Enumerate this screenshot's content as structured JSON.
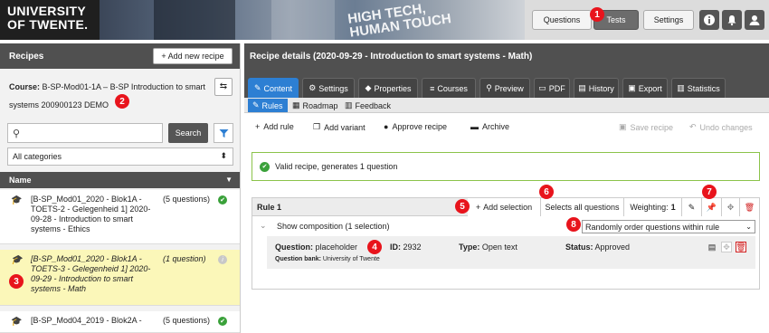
{
  "colors": {
    "accent": "#2d7fd3",
    "marker": "#e8141c",
    "success": "#3aa13a",
    "highlight": "#fbf7b9",
    "danger": "#d02020"
  },
  "header": {
    "logo_line1": "UNIVERSITY",
    "logo_line2": "OF TWENTE.",
    "banner_text_1": "HIGH TECH,",
    "banner_text_2": "HUMAN TOUCH",
    "nav": {
      "questions": "Questions",
      "tests": "Tests",
      "settings": "Settings"
    },
    "icons": [
      "info-icon",
      "bell-icon",
      "user-icon"
    ]
  },
  "markers": [
    "1",
    "2",
    "3",
    "4",
    "5",
    "6",
    "7",
    "8"
  ],
  "left": {
    "title": "Recipes",
    "add_button": "+ Add new recipe",
    "course_label": "Course:",
    "course_value": "B-SP-Mod01-1A – B-SP Introduction to smart systems 200900123 DEMO",
    "search_placeholder": "",
    "search_button": "Search",
    "category_select": "All categories",
    "list_header": "Name",
    "items": [
      {
        "text": "[B-SP_Mod01_2020 - Blok1A - TOETS-2 - Gelegenheid 1] 2020-09-28 - Introduction to smart systems - Ethics",
        "count": "(5 questions)",
        "status": "valid"
      },
      {
        "text": "[B-SP_Mod01_2020 - Blok1A - TOETS-3 - Gelegenheid 1] 2020-09-29 - Introduction to smart systems - Math",
        "count": "(1 question)",
        "status": "info"
      },
      {
        "text": "[B-SP_Mod04_2019 - Blok2A -",
        "count": "(5 questions)",
        "status": "valid"
      }
    ]
  },
  "right": {
    "title": "Recipe details  (2020-09-29 - Introduction to smart systems - Math)",
    "tabs": [
      "Content",
      "Settings",
      "Properties",
      "Courses",
      "Preview",
      "PDF",
      "History",
      "Export",
      "Statistics"
    ],
    "subtabs": [
      "Rules",
      "Roadmap",
      "Feedback"
    ],
    "toolbar": {
      "add_rule": "Add rule",
      "add_variant": "Add variant",
      "approve": "Approve recipe",
      "archive": "Archive",
      "save": "Save recipe",
      "undo": "Undo changes"
    },
    "valid_message": "Valid recipe, generates 1 question",
    "rule": {
      "title": "Rule 1",
      "add_selection": "Add selection",
      "select_all": "Selects all questions",
      "weighting_label": "Weighting:",
      "weighting_value": "1",
      "show_composition": "Show composition (1 selection)",
      "order_option": "Randomly order questions within rule",
      "question_label": "Question:",
      "question_value": "placeholder",
      "id_label": "ID:",
      "id_value": "2932",
      "type_label": "Type:",
      "type_value": "Open text",
      "status_label": "Status:",
      "status_value": "Approved",
      "bank_label": "Question bank:",
      "bank_value": "University of Twente"
    }
  }
}
